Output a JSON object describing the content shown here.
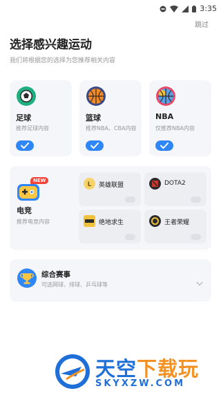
{
  "status_bar": {
    "time": "3:35",
    "icons": [
      "minus-circle-icon",
      "wifi-icon",
      "signal-icon",
      "battery-icon"
    ]
  },
  "header": {
    "skip_label": "跳过",
    "title": "选择感兴趣运动",
    "subtitle": "我们将根据您的选择为您推荐相关内容"
  },
  "sports": [
    {
      "name": "足球",
      "desc": "推荐足球内容",
      "icon": "soccer-ball-icon",
      "selected": true
    },
    {
      "name": "篮球",
      "desc": "推荐NBA、CBA内容",
      "icon": "basketball-icon",
      "selected": true
    },
    {
      "name": "NBA",
      "desc": "仅推荐NBA内容",
      "icon": "nba-basketball-icon",
      "selected": true
    }
  ],
  "esports": {
    "badge": "NEW",
    "name": "电竞",
    "desc": "推荐电竞内容",
    "icon": "gamepad-icon",
    "games": [
      {
        "name": "英雄联盟",
        "icon": "lol-icon",
        "selected": false
      },
      {
        "name": "DOTA2",
        "icon": "dota2-icon",
        "selected": false
      },
      {
        "name": "绝地求生",
        "icon": "pubg-icon",
        "selected": false
      },
      {
        "name": "王者荣耀",
        "icon": "honor-of-kings-icon",
        "selected": false
      }
    ]
  },
  "combo": {
    "name": "综合赛事",
    "desc": "可选网球、排球、乒乓球等",
    "icon": "trophy-icon"
  },
  "watermark": {
    "name_part1": "天空",
    "name_part2": "下载玩",
    "url": "SKYXZW.COM"
  },
  "colors": {
    "accent": "#2f86f6",
    "card_bg": "#f4f6f9",
    "badge_red": "#f2443a"
  }
}
